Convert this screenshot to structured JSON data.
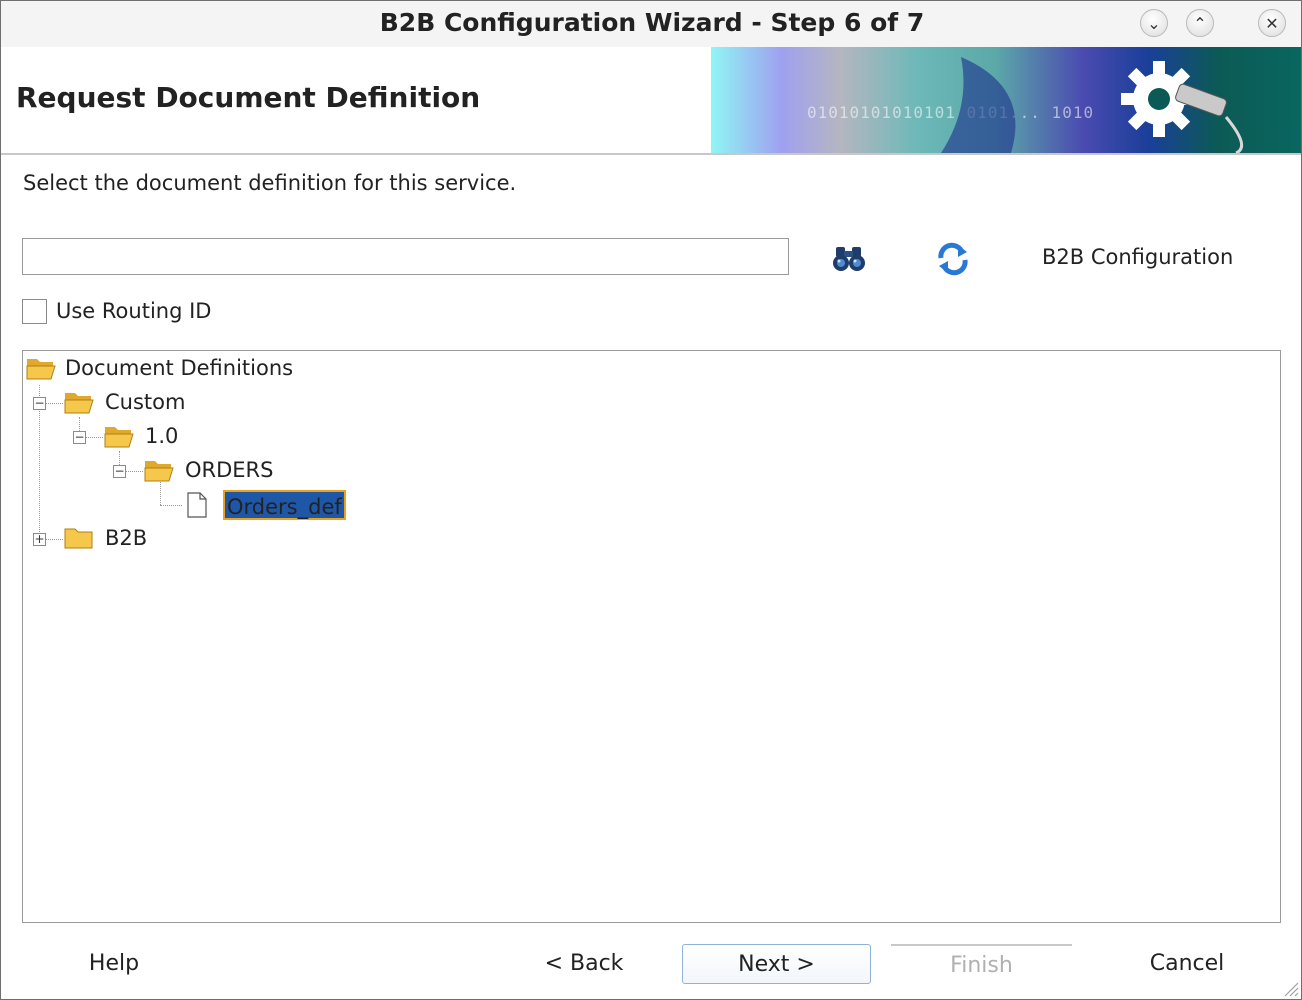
{
  "window": {
    "title": "B2B Configuration Wizard - Step 6 of 7",
    "buttons": {
      "minimize": "⌄",
      "maximize": "⌃",
      "close": "✕"
    }
  },
  "header": {
    "page_title": "Request Document Definition",
    "banner_digits": "01010101010101 0101... 1010"
  },
  "main": {
    "instructions": "Select the document definition for this service.",
    "search": {
      "value": "",
      "placeholder": ""
    },
    "b2b_configuration_label": "B2B Configuration",
    "use_routing_id": {
      "label": "Use Routing ID",
      "checked": false
    }
  },
  "tree": {
    "root": "Document Definitions",
    "custom": "Custom",
    "version": "1.0",
    "orders": "ORDERS",
    "selected_leaf": "Orders_def",
    "b2b": "B2B"
  },
  "footer": {
    "help": "Help",
    "back": "< Back",
    "next": "Next >",
    "finish": "Finish",
    "cancel": "Cancel"
  },
  "icons": [
    "binoculars-icon",
    "refresh-icon",
    "folder-open-icon",
    "folder-closed-icon",
    "document-icon",
    "resize-grip-icon"
  ],
  "colors": {
    "selection": "#1f57a8",
    "selection_border": "#e8a21c",
    "folder": "#f5c84c"
  }
}
